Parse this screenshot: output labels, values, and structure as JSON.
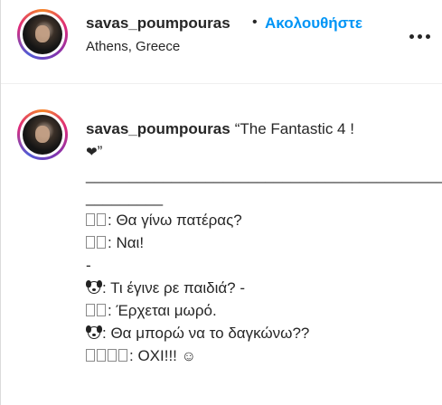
{
  "header": {
    "username": "savas_poumpouras",
    "dot": "•",
    "follow": "Ακολουθήστε",
    "location": "Athens, Greece"
  },
  "caption": {
    "username": "savas_poumpouras",
    "title": "“The Fantastic 4 !",
    "heart": "❤",
    "quote_close": "”",
    "rule_1": "__________________________________________",
    "rule_2": "_________",
    "lines": [
      ": Θα γίνω πατέρας?",
      ": Ναι!",
      "-",
      ": Τι έγινε ρε παιδιά? -",
      ": Έρχεται μωρό.",
      ": Θα μπορώ να το δαγκώνω??",
      ": ΟΧΙ!!!"
    ],
    "smile": "☺"
  }
}
